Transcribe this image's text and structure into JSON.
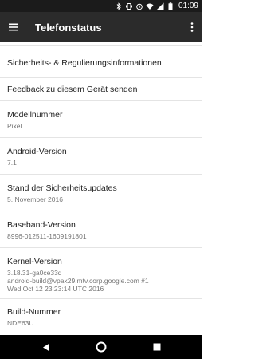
{
  "status_bar": {
    "time": "01:09",
    "icons": [
      "bluetooth-icon",
      "vibrate-icon",
      "alarm-icon",
      "wifi-icon",
      "signal-icon",
      "battery-icon"
    ]
  },
  "app_bar": {
    "title": "Telefonstatus",
    "menu_icon": "hamburger-icon",
    "more_icon": "overflow-menu-icon"
  },
  "rows": [
    {
      "label": "Sicherheits- & Regulierungsinformationen"
    },
    {
      "label": "Feedback zu diesem Gerät senden"
    },
    {
      "label": "Modellnummer",
      "value": "Pixel"
    },
    {
      "label": "Android-Version",
      "value": "7.1"
    },
    {
      "label": "Stand der Sicherheitsupdates",
      "value": "5. November 2016"
    },
    {
      "label": "Baseband-Version",
      "value": "8996-012511-1609191801"
    },
    {
      "label": "Kernel-Version",
      "value_lines": [
        "3.18.31-ga0ce33d",
        "android-build@vpak29.mtv.corp.google.com #1",
        "Wed Oct 12 23:23:14 UTC 2016"
      ]
    },
    {
      "label": "Build-Nummer",
      "value": "NDE63U"
    }
  ],
  "nav_bar": {
    "back_icon": "back-icon",
    "home_icon": "home-icon",
    "recents_icon": "recents-icon"
  }
}
